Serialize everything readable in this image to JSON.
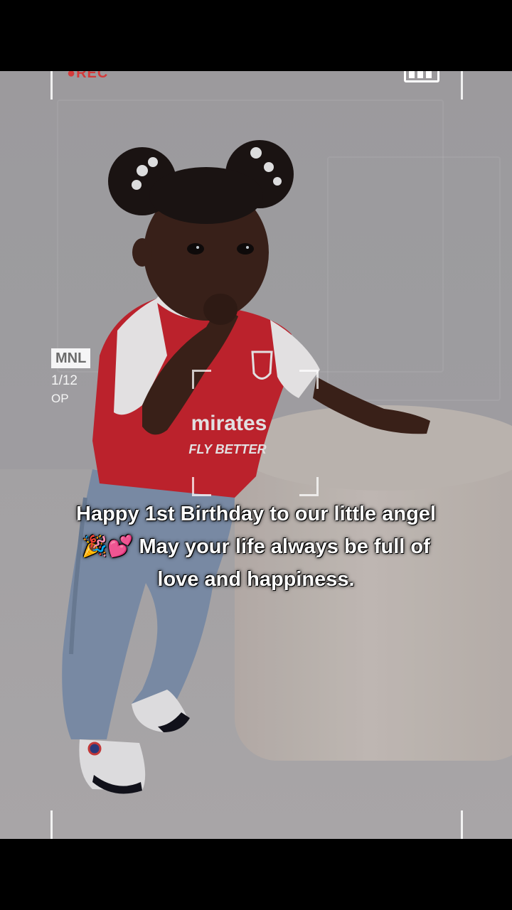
{
  "camera_overlay": {
    "rec_label": "●REC",
    "format_badge": "MNL",
    "frame_counter": "1/12",
    "mode_label": "OP"
  },
  "caption": {
    "line1": "Happy 1st Birthday to our little angel",
    "line2_emoji": "🎉💕",
    "line2_text": "May your life always be full of",
    "line3": "love and happiness."
  },
  "jersey": {
    "sponsor_line1": "mirates",
    "sponsor_line2": "FLY BETTER"
  },
  "colors": {
    "jersey_red": "#c8222c",
    "jeans_blue": "#7f92ad",
    "rec_red": "#d53a3a"
  },
  "icons": [
    "battery-icon",
    "focus-bracket-icon",
    "arsenal-crest-icon"
  ]
}
